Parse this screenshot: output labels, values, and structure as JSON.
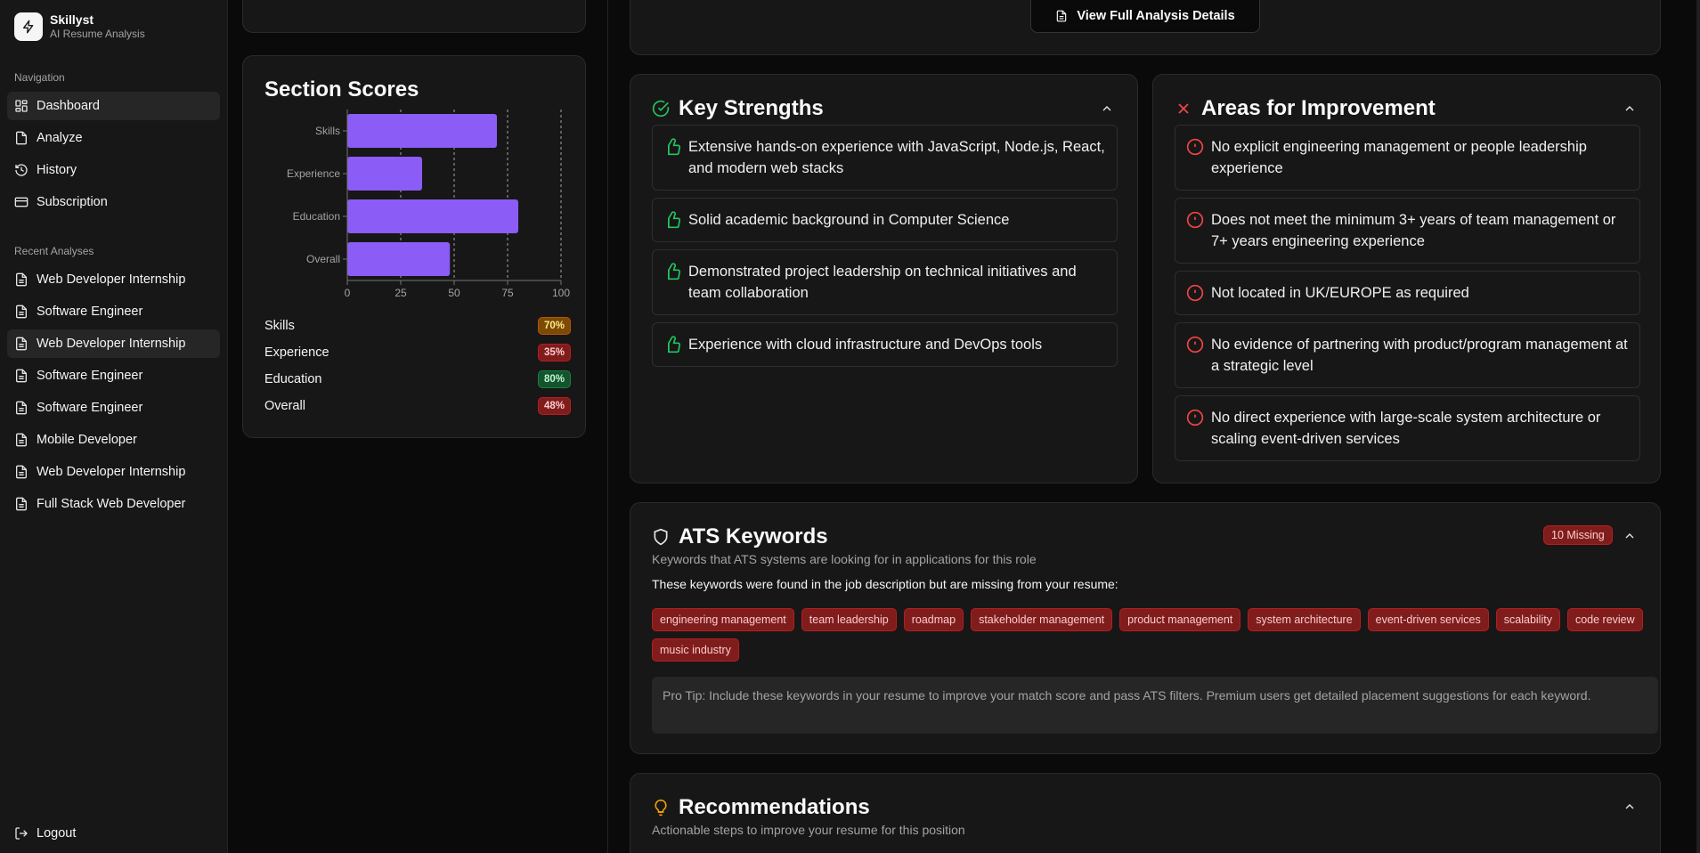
{
  "brand": {
    "name": "Skillyst",
    "tagline": "AI Resume Analysis"
  },
  "nav": {
    "heading": "Navigation",
    "items": [
      {
        "label": "Dashboard",
        "icon": "dashboard-icon"
      },
      {
        "label": "Analyze",
        "icon": "file-icon"
      },
      {
        "label": "History",
        "icon": "history-icon"
      },
      {
        "label": "Subscription",
        "icon": "card-icon"
      }
    ]
  },
  "recent": {
    "heading": "Recent Analyses",
    "items": [
      "Web Developer Internship",
      "Software Engineer",
      "Web Developer Internship",
      "Software Engineer",
      "Software Engineer",
      "Mobile Developer",
      "Web Developer Internship",
      "Full Stack Web Developer"
    ]
  },
  "logout_label": "Logout",
  "section_scores": {
    "title": "Section Scores",
    "rows": [
      {
        "label": "Skills",
        "value": "70%"
      },
      {
        "label": "Experience",
        "value": "35%"
      },
      {
        "label": "Education",
        "value": "80%"
      },
      {
        "label": "Overall",
        "value": "48%"
      }
    ]
  },
  "chart_data": {
    "type": "bar",
    "orientation": "horizontal",
    "categories": [
      "Skills",
      "Experience",
      "Education",
      "Overall"
    ],
    "values": [
      70,
      35,
      80,
      48
    ],
    "xlim": [
      0,
      100
    ],
    "xticks": [
      0,
      25,
      50,
      75,
      100
    ],
    "grid": "vertical dashed",
    "bar_color": "#8b5cf6"
  },
  "view_full_label": "View Full Analysis Details",
  "strengths": {
    "title": "Key Strengths",
    "items": [
      "Extensive hands-on experience with JavaScript, Node.js, React, and modern web stacks",
      "Solid academic background in Computer Science",
      "Demonstrated project leadership on technical initiatives and team collaboration",
      "Experience with cloud infrastructure and DevOps tools"
    ]
  },
  "improvements": {
    "title": "Areas for Improvement",
    "items": [
      "No explicit engineering management or people leadership experience",
      "Does not meet the minimum 3+ years of team management or 7+ years engineering experience",
      "Not located in UK/EUROPE as required",
      "No evidence of partnering with product/program management at a strategic level",
      "No direct experience with large-scale system architecture or scaling event-driven services"
    ]
  },
  "ats": {
    "title": "ATS Keywords",
    "missing_badge": "10 Missing",
    "subtitle": "Keywords that ATS systems are looking for in applications for this role",
    "note": "These keywords were found in the job description but are missing from your resume:",
    "keywords": [
      "engineering management",
      "team leadership",
      "roadmap",
      "stakeholder management",
      "product management",
      "system architecture",
      "event-driven services",
      "scalability",
      "code review",
      "music industry"
    ],
    "tip_label": "Pro Tip:",
    "tip_text": " Include these keywords in your resume to improve your match score and pass ATS filters. Premium users get detailed placement suggestions for each keyword."
  },
  "recommendations": {
    "title": "Recommendations",
    "subtitle": "Actionable steps to improve your resume for this position"
  },
  "colors": {
    "accent": "#8b5cf6",
    "success": "#22c55e",
    "danger": "#ef4444",
    "warning": "#f59e0b"
  }
}
